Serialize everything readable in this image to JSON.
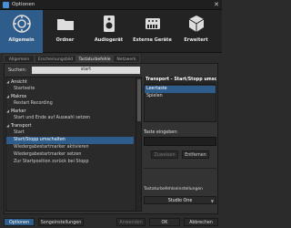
{
  "window": {
    "title": "Optionen",
    "close_glyph": "✕",
    "icon": "app-icon"
  },
  "categories": [
    {
      "label": "Allgemein",
      "icon": "gear-icon",
      "active": true
    },
    {
      "label": "Ordner",
      "icon": "folder-icon",
      "active": false
    },
    {
      "label": "Audiogerät",
      "icon": "speaker-icon",
      "active": false
    },
    {
      "label": "Externe Geräte",
      "icon": "external-device-icon",
      "active": false
    },
    {
      "label": "Erweitert",
      "icon": "cube-icon",
      "active": false
    }
  ],
  "tabs": [
    {
      "label": "Allgemein",
      "active": false
    },
    {
      "label": "Erscheinungsbild",
      "active": false
    },
    {
      "label": "Tastaturbefehle",
      "active": true
    },
    {
      "label": "Netzwerk",
      "active": false
    }
  ],
  "search": {
    "label": "Suchen:",
    "value": "start"
  },
  "tree": [
    {
      "text": "Ansicht",
      "type": "group",
      "expanded": true
    },
    {
      "text": "Startseite",
      "type": "item"
    },
    {
      "text": "Makros",
      "type": "group",
      "expanded": true
    },
    {
      "text": "Restart Recording",
      "type": "item"
    },
    {
      "text": "Marker",
      "type": "group",
      "expanded": true
    },
    {
      "text": "Start und Ende auf Auswahl setzen",
      "type": "item"
    },
    {
      "text": "Transport",
      "type": "group",
      "expanded": true
    },
    {
      "text": "Start",
      "type": "item"
    },
    {
      "text": "Start/Stopp umschalten",
      "type": "item",
      "selected": true
    },
    {
      "text": "Wiedergabestartmarker aktivieren",
      "type": "item"
    },
    {
      "text": "Wiedergabestartmarker setzen",
      "type": "item"
    },
    {
      "text": "Zur Startposition zurück bei Stopp",
      "type": "item"
    }
  ],
  "detail": {
    "heading": "Transport - Start/Stopp umschalten",
    "keys": [
      {
        "text": "Leertaste",
        "selected": true
      },
      {
        "text": "Spielen",
        "selected": false
      }
    ],
    "key_label": "Taste eingeben:",
    "assign_label": "Zuweisen",
    "remove_label": "Entfernen",
    "set_label": "Tastaturbefehlseinstellungen",
    "set_value": "Studio One",
    "chevron": "▼"
  },
  "footer": {
    "options": "Optionen",
    "song_settings": "Songeinstellungen",
    "apply": "Anwenden",
    "ok": "OK",
    "cancel": "Abbrechen"
  },
  "colors": {
    "accent": "#2e5d8c",
    "background": "#2b2b2b"
  }
}
